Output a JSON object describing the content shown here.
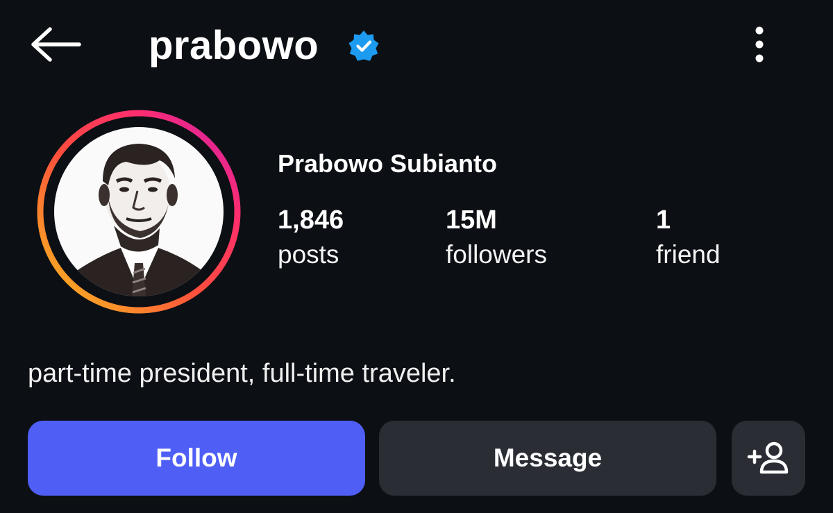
{
  "header": {
    "username": "prabowo",
    "verified": true,
    "icons": {
      "back": "back-arrow-icon",
      "verified": "verified-badge-icon",
      "more": "more-options-icon"
    }
  },
  "profile": {
    "display_name": "Prabowo Subianto",
    "avatar": "profile-portrait",
    "story_ring": true,
    "stats": [
      {
        "value": "1,846",
        "label": "posts"
      },
      {
        "value": "15M",
        "label": "followers"
      },
      {
        "value": "1",
        "label": "friend"
      }
    ],
    "bio": "part-time president, full-time traveler."
  },
  "actions": {
    "follow_label": "Follow",
    "message_label": "Message",
    "add_friend_icon": "add-person-icon"
  },
  "colors": {
    "background": "#0c0f14",
    "follow_button": "#4f5ff6",
    "secondary_button": "#2a2d34",
    "verified_badge": "#1d9bf0",
    "ring_gradient": [
      "#f9a825",
      "#ff2d55",
      "#c51fb5"
    ]
  }
}
